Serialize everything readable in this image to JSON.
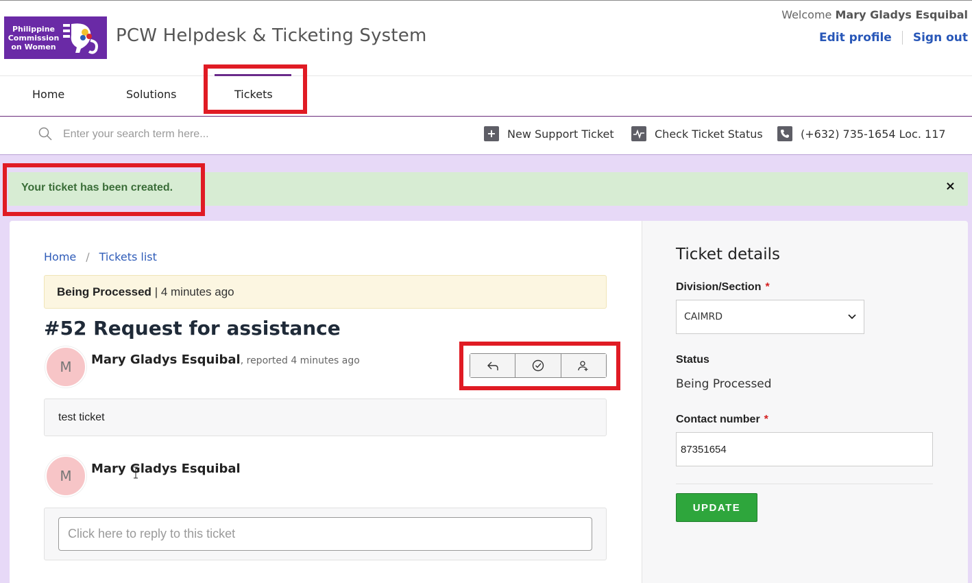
{
  "header": {
    "logo_text": [
      "Philippine",
      "Commission",
      "on Women"
    ],
    "app_title": "PCW Helpdesk & Ticketing System",
    "welcome_prefix": "Welcome",
    "user_name": "Mary Gladys Esquibal",
    "edit_profile": "Edit profile",
    "sign_out": "Sign out"
  },
  "nav": {
    "items": [
      {
        "label": "Home"
      },
      {
        "label": "Solutions"
      },
      {
        "label": "Tickets",
        "active": true
      }
    ]
  },
  "toolbar": {
    "search_placeholder": "Enter your search term here...",
    "new_ticket": "New Support Ticket",
    "check_status": "Check Ticket Status",
    "phone": "(+632) 735-1654 Loc. 117"
  },
  "alert": {
    "message": "Your ticket has been created.",
    "close": "×"
  },
  "breadcrumb": {
    "home": "Home",
    "sep": "/",
    "tickets_list": "Tickets list"
  },
  "ticket": {
    "status": "Being Processed",
    "status_time": "| 4 minutes ago",
    "title": "#52 Request for assistance",
    "author_initial": "M",
    "author": "Mary Gladys Esquibal",
    "reported": ", reported 4 minutes ago",
    "message": "test ticket",
    "reply_author": "Mary Gladys Esquibal",
    "reply_placeholder": "Click here to reply to this ticket"
  },
  "details": {
    "title": "Ticket details",
    "division_label": "Division/Section",
    "division_value": "CAIMRD",
    "status_label": "Status",
    "status_value": "Being Processed",
    "contact_label": "Contact number",
    "contact_value": "87351654",
    "required_mark": "*",
    "update_button": "UPDATE"
  },
  "colors": {
    "brand_purple": "#6a2aa6",
    "link_blue": "#2857b8",
    "highlight_red": "#e01b24",
    "success_green": "#2ea63c",
    "page_bg": "#e7d9f7"
  }
}
